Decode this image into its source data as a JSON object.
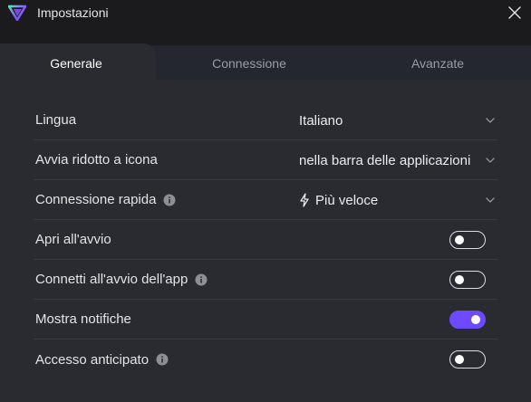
{
  "window": {
    "title": "Impostazioni",
    "close_icon": "close-icon",
    "logo_icon": "proton-vpn-logo"
  },
  "tabs": [
    {
      "label": "Generale",
      "active": true
    },
    {
      "label": "Connessione",
      "active": false
    },
    {
      "label": "Avanzate",
      "active": false
    }
  ],
  "settings": {
    "language": {
      "label": "Lingua",
      "value": "Italiano"
    },
    "start_minimized": {
      "label": "Avvia ridotto a icona",
      "value": "nella barra delle applicazioni"
    },
    "quick_connect": {
      "label": "Connessione rapida",
      "value": "Più veloce",
      "value_icon": "bolt-icon",
      "has_info": true
    },
    "open_on_startup": {
      "label": "Apri all'avvio",
      "enabled": false
    },
    "connect_on_app_start": {
      "label": "Connetti all'avvio dell'app",
      "enabled": false,
      "has_info": true
    },
    "show_notifications": {
      "label": "Mostra notifiche",
      "enabled": true
    },
    "early_access": {
      "label": "Accesso anticipato",
      "enabled": false,
      "has_info": true
    }
  },
  "colors": {
    "accent": "#6d4aff",
    "background": "#2a2b30",
    "titlebar": "#1b1b1e",
    "divider": "#393a40"
  }
}
